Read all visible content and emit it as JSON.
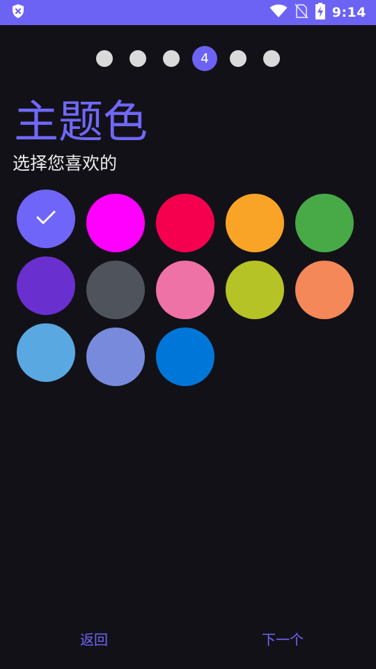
{
  "status_bar": {
    "time": "9:14",
    "icons": [
      "shield-x-icon",
      "wifi-icon",
      "no-sim-icon",
      "battery-charging-icon"
    ]
  },
  "stepper": {
    "total_steps": 6,
    "current_step": 4,
    "current_label": "4"
  },
  "header": {
    "title": "主题色",
    "subtitle": "选择您喜欢的"
  },
  "colors": {
    "accent": "#6C63F5",
    "background": "#131118",
    "swatches": [
      {
        "color": "#7065F9",
        "selected": true
      },
      {
        "color": "#FF00FF",
        "selected": false
      },
      {
        "color": "#F5004F",
        "selected": false
      },
      {
        "color": "#F9A427",
        "selected": false
      },
      {
        "color": "#47AA47",
        "selected": false
      },
      {
        "color": "#6A2FCF",
        "selected": false
      },
      {
        "color": "#4F535B",
        "selected": false
      },
      {
        "color": "#EF72A6",
        "selected": false
      },
      {
        "color": "#B6C326",
        "selected": false
      },
      {
        "color": "#F48859",
        "selected": false
      },
      {
        "color": "#5AA8E2",
        "selected": false
      },
      {
        "color": "#788ADB",
        "selected": false
      },
      {
        "color": "#0077D8",
        "selected": false
      }
    ]
  },
  "footer": {
    "back_label": "返回",
    "next_label": "下一个"
  }
}
